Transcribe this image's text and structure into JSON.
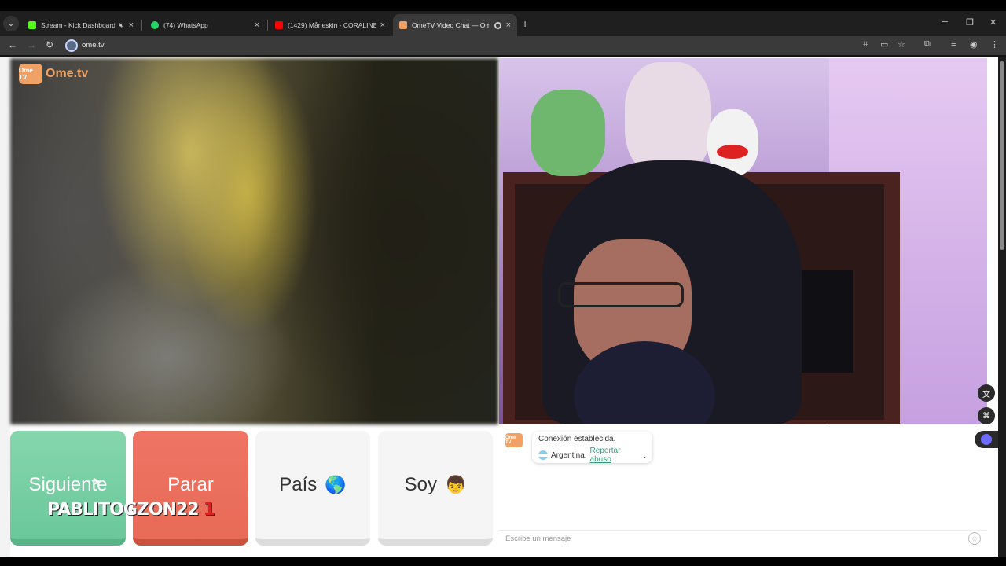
{
  "browser": {
    "tabs": [
      {
        "label": "Stream - Kick Dashboard",
        "favicon_color": "#53fc18",
        "muted": true
      },
      {
        "label": "(74) WhatsApp",
        "favicon_color": "#25d366"
      },
      {
        "label": "(1429) Måneskin - CORALINE (I",
        "favicon_color": "#ff0000"
      },
      {
        "label": "OmeTV Video Chat — Ome",
        "favicon_color": "#f0a266",
        "active": true,
        "recording": true
      }
    ],
    "new_tab_label": "+",
    "close_glyph": "×",
    "url": "ome.tv"
  },
  "ometv": {
    "logo_badge": "Ome TV",
    "logo_word": "Ome.tv",
    "buttons": {
      "next": "Siguiente",
      "stop": "Parar",
      "country": "País",
      "country_emoji": "🌎",
      "gender": "Soy",
      "gender_emoji": "👦"
    },
    "overlay": {
      "name": "PABLITOGZON22",
      "count": "1"
    },
    "chat": {
      "avatar": "Ome TV",
      "line1": "Conexión establecida.",
      "country": "Argentina.",
      "report_link": "Reportar abuso",
      "report_suffix": ".",
      "input_placeholder": "Escribe un mensaje"
    }
  },
  "colors": {
    "accent": "#f0a266",
    "next": "#6ac89a",
    "stop": "#e86b58",
    "link": "#3a9a7a"
  }
}
